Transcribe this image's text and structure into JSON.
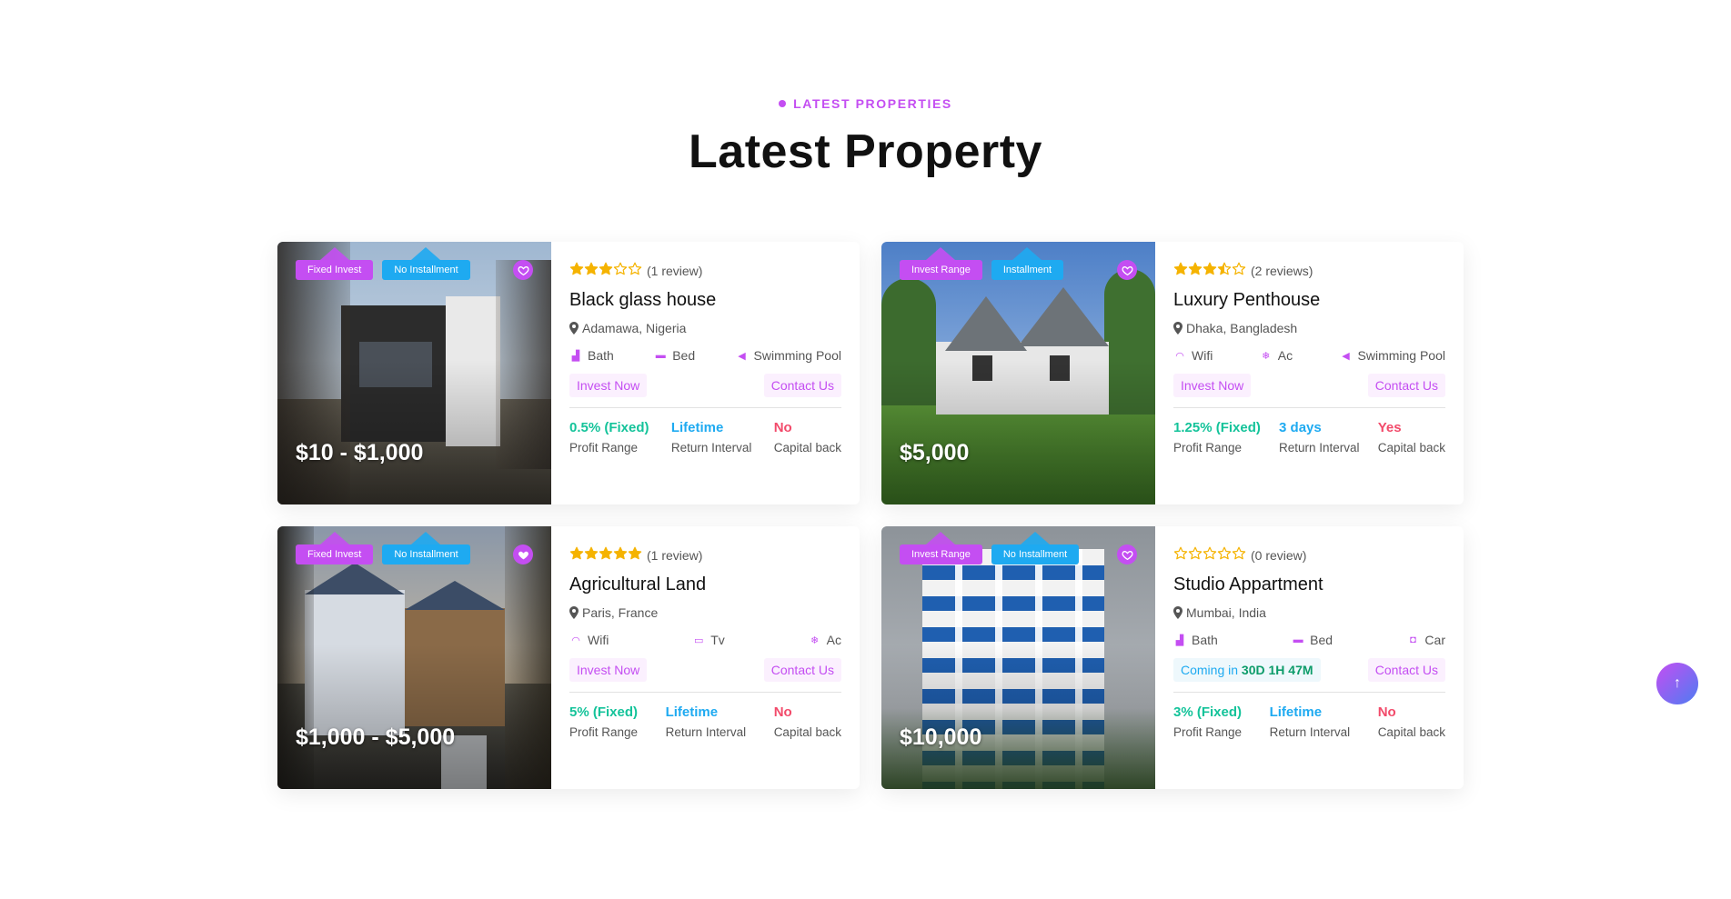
{
  "section": {
    "eyebrow": "LATEST PROPERTIES",
    "title": "Latest Property"
  },
  "colors": {
    "accent": "#c44ef2",
    "blue": "#1eaaf1",
    "green": "#14c39a",
    "red": "#f24a6a",
    "star": "#f5b301"
  },
  "properties": [
    {
      "badge1": "Fixed Invest",
      "badge2": "No Installment",
      "price": "$10 - $1,000",
      "rating": 3,
      "reviews": "(1 review)",
      "title": "Black glass house",
      "location": "Adamawa, Nigeria",
      "features": [
        {
          "icon": "bath-icon",
          "label": "Bath"
        },
        {
          "icon": "bed-icon",
          "label": "Bed"
        },
        {
          "icon": "swimming-pool-icon",
          "label": "Swimming Pool"
        }
      ],
      "action_primary": "Invest Now",
      "action_secondary": "Contact Us",
      "stats": [
        {
          "value": "0.5% (Fixed)",
          "label": "Profit Range"
        },
        {
          "value": "Lifetime",
          "label": "Return Interval"
        },
        {
          "value": "No",
          "label": "Capital back"
        }
      ]
    },
    {
      "badge1": "Invest Range",
      "badge2": "Installment",
      "price": "$5,000",
      "rating": 3.5,
      "reviews": "(2 reviews)",
      "title": "Luxury Penthouse",
      "location": "Dhaka, Bangladesh",
      "features": [
        {
          "icon": "wifi-icon",
          "label": "Wifi"
        },
        {
          "icon": "ac-icon",
          "label": "Ac"
        },
        {
          "icon": "swimming-pool-icon",
          "label": "Swimming Pool"
        }
      ],
      "action_primary": "Invest Now",
      "action_secondary": "Contact Us",
      "stats": [
        {
          "value": "1.25% (Fixed)",
          "label": "Profit Range"
        },
        {
          "value": "3 days",
          "label": "Return Interval"
        },
        {
          "value": "Yes",
          "label": "Capital back"
        }
      ]
    },
    {
      "badge1": "Fixed Invest",
      "badge2": "No Installment",
      "price": "$1,000 - $5,000",
      "rating": 5,
      "reviews": "(1 review)",
      "title": "Agricultural Land",
      "location": "Paris, France",
      "features": [
        {
          "icon": "wifi-icon",
          "label": "Wifi"
        },
        {
          "icon": "tv-icon",
          "label": "Tv"
        },
        {
          "icon": "ac-icon",
          "label": "Ac"
        }
      ],
      "action_primary": "Invest Now",
      "action_secondary": "Contact Us",
      "stats": [
        {
          "value": "5% (Fixed)",
          "label": "Profit Range"
        },
        {
          "value": "Lifetime",
          "label": "Return Interval"
        },
        {
          "value": "No",
          "label": "Capital back"
        }
      ]
    },
    {
      "badge1": "Invest Range",
      "badge2": "No Installment",
      "price": "$10,000",
      "rating": 0,
      "reviews": "(0 review)",
      "title": "Studio Appartment",
      "location": "Mumbai, India",
      "features": [
        {
          "icon": "bath-icon",
          "label": "Bath"
        },
        {
          "icon": "bed-icon",
          "label": "Bed"
        },
        {
          "icon": "car-icon",
          "label": "Car"
        }
      ],
      "coming_prefix": "Coming in",
      "coming_time": "30D 1H 47M",
      "action_secondary": "Contact Us",
      "stats": [
        {
          "value": "3% (Fixed)",
          "label": "Profit Range"
        },
        {
          "value": "Lifetime",
          "label": "Return Interval"
        },
        {
          "value": "No",
          "label": "Capital back"
        }
      ]
    }
  ],
  "scroll_top": {
    "icon": "arrow-up-icon",
    "glyph": "↑"
  }
}
